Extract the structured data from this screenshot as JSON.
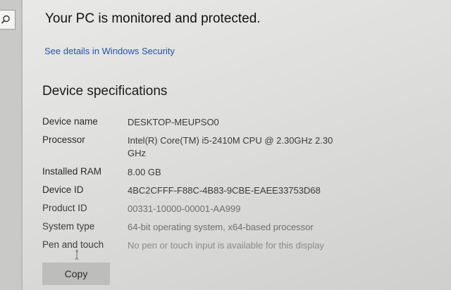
{
  "security": {
    "status_title": "Your PC is monitored and protected.",
    "details_link": "See details in Windows Security"
  },
  "device_specs": {
    "section_title": "Device specifications",
    "rows": [
      {
        "label": "Device name",
        "value": "DESKTOP-MEUPSO0"
      },
      {
        "label": "Processor",
        "value": "Intel(R) Core(TM) i5-2410M CPU @ 2.30GHz   2.30 GHz"
      },
      {
        "label": "Installed RAM",
        "value": "8.00 GB"
      },
      {
        "label": "Device ID",
        "value": "4BC2CFFF-F88C-4B83-9CBE-EAEE33753D68"
      },
      {
        "label": "Product ID",
        "value": "00331-10000-00001-AA999"
      },
      {
        "label": "System type",
        "value": "64-bit operating system, x64-based processor"
      },
      {
        "label": "Pen and touch",
        "value": "No pen or touch input is available for this display"
      }
    ],
    "copy_button_label": "Copy"
  },
  "icons": {
    "search": "search-icon",
    "cursor": "mouse-cursor-icon"
  }
}
